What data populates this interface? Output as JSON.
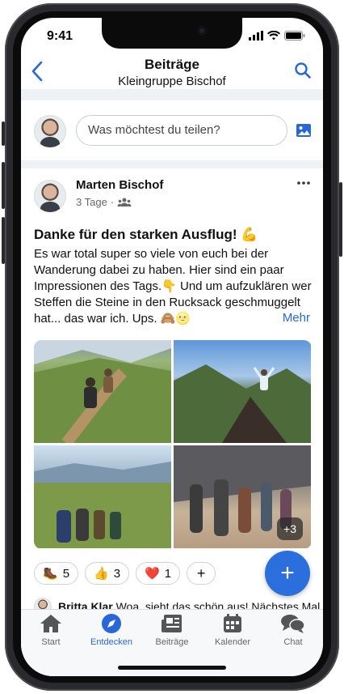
{
  "status": {
    "time": "9:41"
  },
  "header": {
    "title": "Beiträge",
    "subtitle": "Kleingruppe Bischof"
  },
  "compose": {
    "placeholder": "Was möchtest du teilen?"
  },
  "post": {
    "author": "Marten Bischof",
    "time": "3 Tage",
    "title": "Danke für den starken Ausflug! 💪",
    "body": "Es war total super so viele von euch bei der Wanderung dabei zu haben. Hier sind ein paar Impressionen des Tags.👇 Und um aufzuklären wer Steffen die Steine in den Rucksack geschmuggelt hat... das war ich. Ups. 🙈🌝",
    "more_label": "Mehr",
    "extra_photos": "+3",
    "reactions": [
      {
        "emoji": "🥾",
        "count": "5"
      },
      {
        "emoji": "👍",
        "count": "3"
      },
      {
        "emoji": "❤️",
        "count": "1"
      }
    ],
    "add_reaction": "+",
    "comment": {
      "author": "Britta Klar",
      "text": "Woa, sieht das schön aus! Nächstes Mal"
    }
  },
  "fab": {
    "label": "+"
  },
  "tabs": [
    {
      "label": "Start"
    },
    {
      "label": "Entdecken"
    },
    {
      "label": "Beiträge"
    },
    {
      "label": "Kalender"
    },
    {
      "label": "Chat"
    }
  ],
  "colors": {
    "accent": "#2867d8",
    "fab": "#2b6fdc"
  }
}
